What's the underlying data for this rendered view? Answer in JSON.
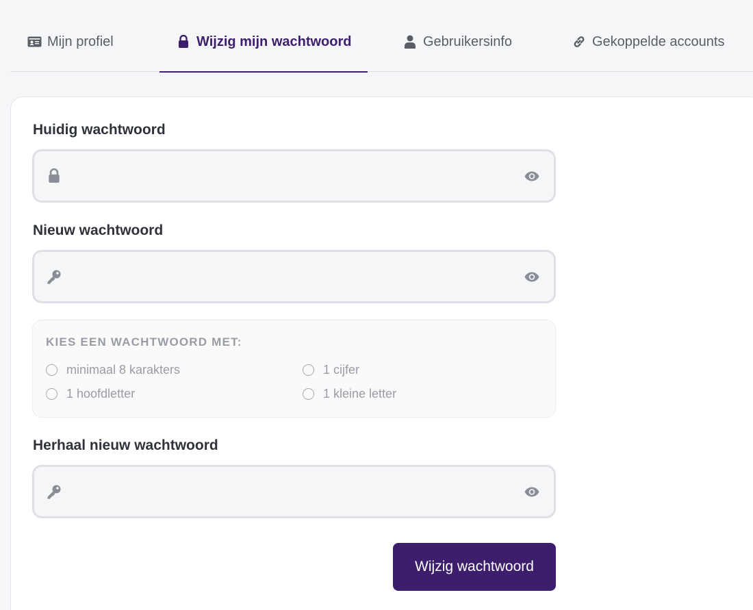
{
  "tabs": [
    {
      "label": "Mijn profiel",
      "icon": "id-card-icon"
    },
    {
      "label": "Wijzig mijn wachtwoord",
      "icon": "lock-icon",
      "active": true
    },
    {
      "label": "Gebruikersinfo",
      "icon": "user-icon"
    },
    {
      "label": "Gekoppelde accounts",
      "icon": "link-icon"
    }
  ],
  "form": {
    "current_password": {
      "label": "Huidig wachtwoord",
      "value": "",
      "icon": "lock-icon",
      "toggle_icon": "eye-icon"
    },
    "new_password": {
      "label": "Nieuw wachtwoord",
      "value": "",
      "icon": "key-icon",
      "toggle_icon": "eye-icon"
    },
    "requirements": {
      "title": "KIES EEN WACHTWOORD MET:",
      "items": [
        "minimaal 8 karakters",
        "1 cijfer",
        "1 hoofdletter",
        "1 kleine letter"
      ]
    },
    "repeat_password": {
      "label": "Herhaal nieuw wachtwoord",
      "value": "",
      "icon": "key-icon",
      "toggle_icon": "eye-icon"
    },
    "submit_label": "Wijzig wachtwoord"
  },
  "colors": {
    "accent": "#3d1e6d",
    "icon_gray": "#8a8d96",
    "muted_text": "#9a9ca5"
  }
}
